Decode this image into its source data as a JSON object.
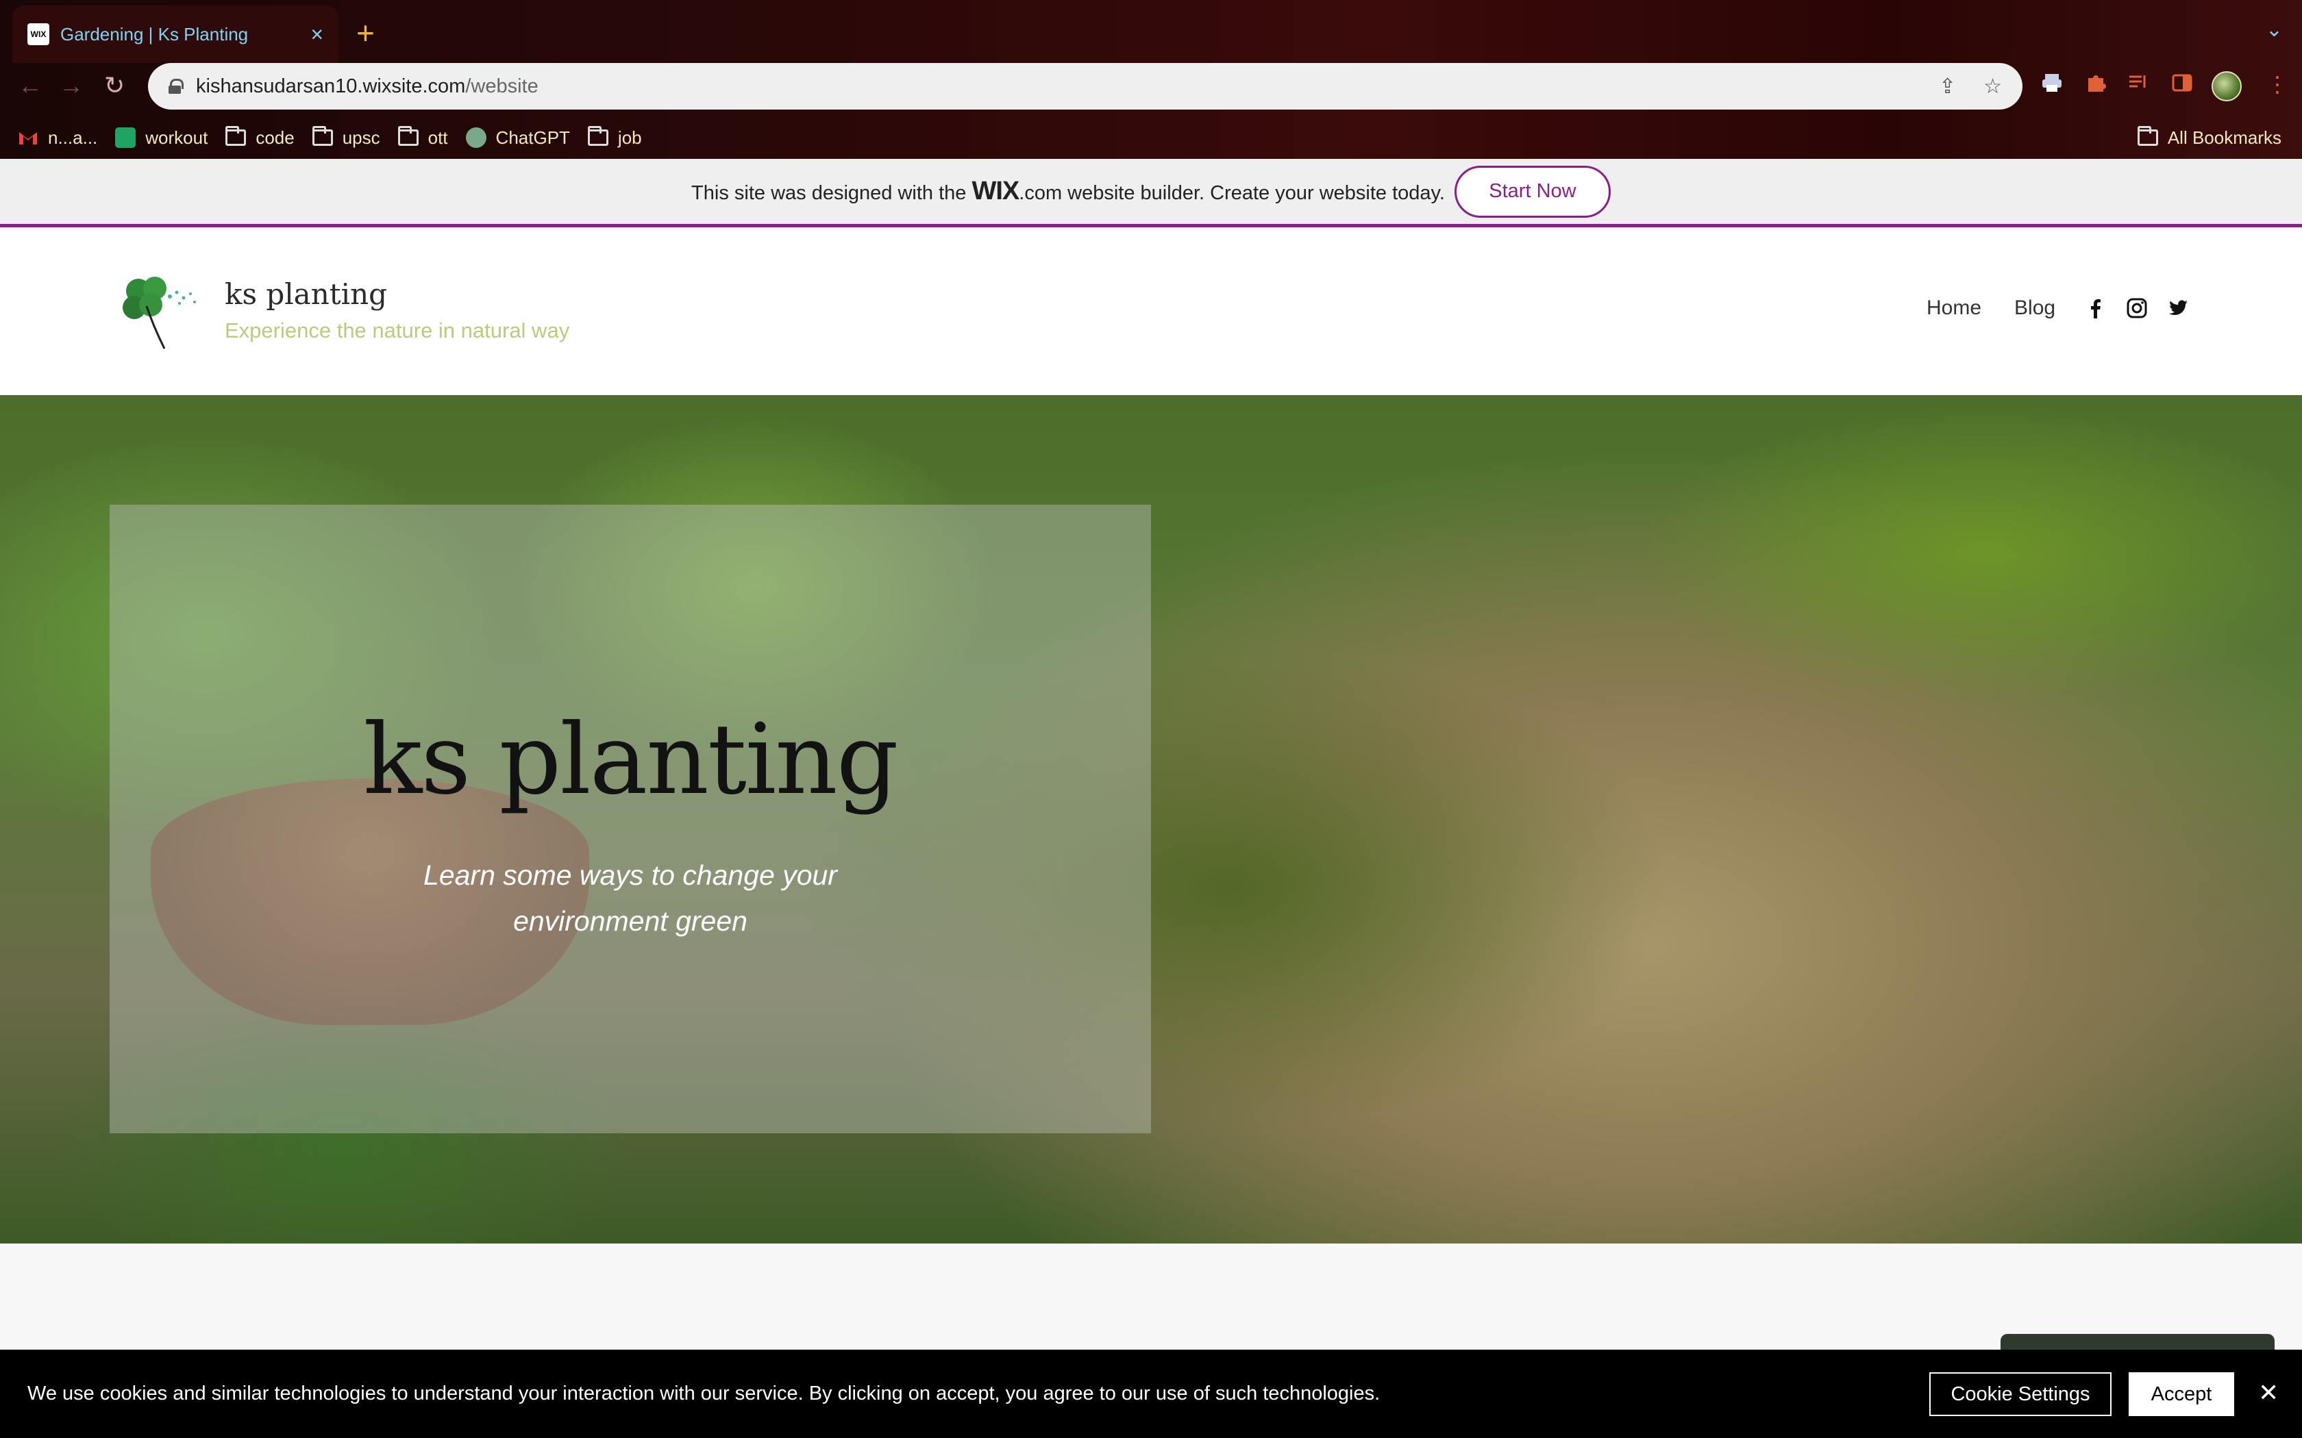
{
  "browser": {
    "tab": {
      "title": "Gardening | Ks Planting",
      "favicon_text": "WIX"
    },
    "url": {
      "host": "kishansudarsan10.wixsite.com",
      "path": "/website"
    },
    "bookmarks": [
      {
        "label": "n...a...",
        "icon": "gmail-icon"
      },
      {
        "label": "workout",
        "icon": "sheets-icon"
      },
      {
        "label": "code",
        "icon": "folder-icon"
      },
      {
        "label": "upsc",
        "icon": "folder-icon"
      },
      {
        "label": "ott",
        "icon": "folder-icon"
      },
      {
        "label": "ChatGPT",
        "icon": "chatgpt-icon"
      },
      {
        "label": "job",
        "icon": "folder-icon"
      }
    ],
    "all_bookmarks": "All Bookmarks"
  },
  "wix_banner": {
    "text_before": "This site was designed with the",
    "logo": "WIX",
    "text_after": ".com website builder. Create your website today.",
    "button": "Start Now"
  },
  "site": {
    "name": "ks planting",
    "tagline": "Experience the nature in natural way",
    "nav": [
      "Home",
      "Blog"
    ],
    "social": [
      "facebook-icon",
      "instagram-icon",
      "twitter-icon"
    ]
  },
  "hero": {
    "title": "ks planting",
    "subtitle_line1": "Learn some ways to change your",
    "subtitle_line2": "environment green"
  },
  "cookie_bar": {
    "text": "We use cookies and similar technologies to understand your interaction with our service. By clicking on accept, you agree to our use of such technologies.",
    "settings_button": "Cookie Settings",
    "accept_button": "Accept"
  },
  "colors": {
    "wix_accent": "#8a1f8a",
    "tagline": "#b8cc7c",
    "chrome_bg": "#2a0808"
  }
}
